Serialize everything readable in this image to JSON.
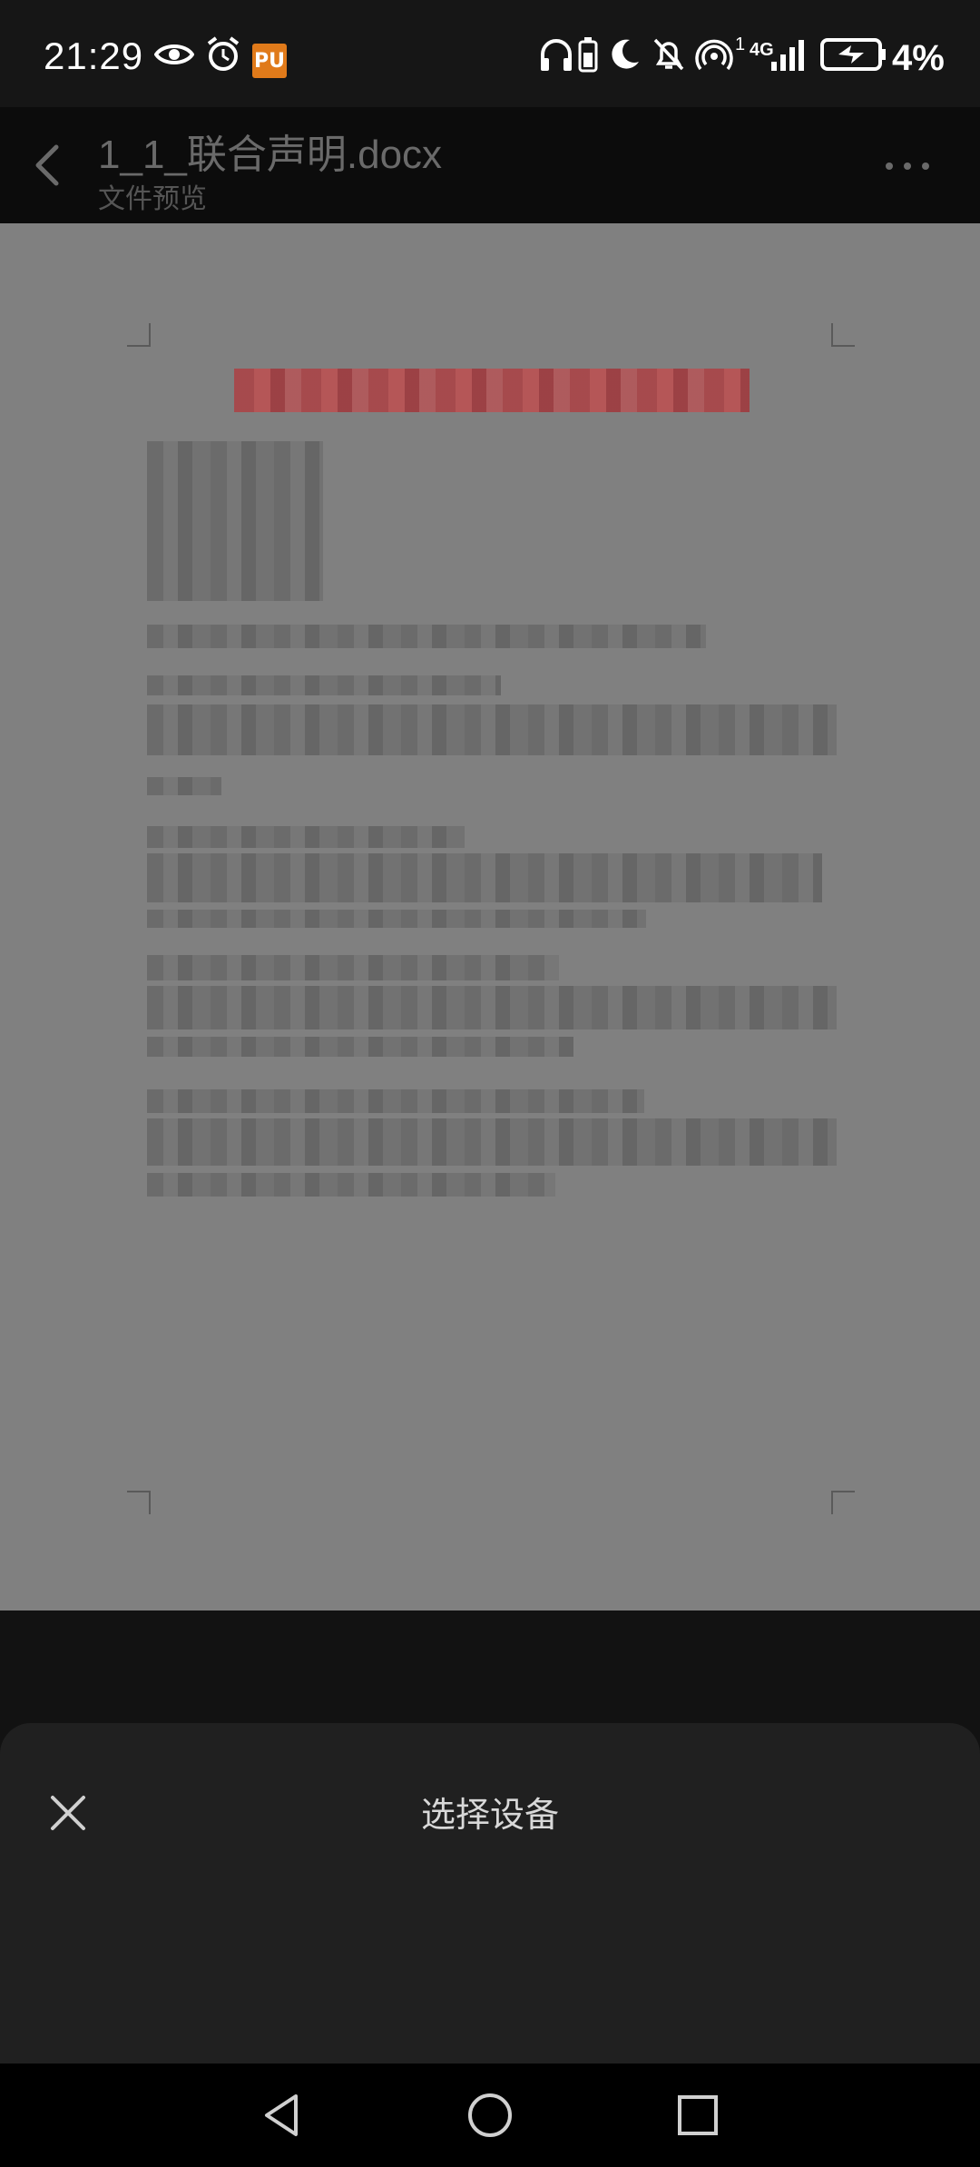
{
  "status_bar": {
    "time": "21:29",
    "battery_percent": "4%",
    "network_label": "4G",
    "sim_slot": "1",
    "app_badge": "PU",
    "icons": [
      "eye-icon",
      "alarm-icon",
      "pu-app-icon",
      "headphones-icon",
      "battery-saver-icon",
      "moon-icon",
      "notifications-off-icon",
      "hotspot-icon",
      "signal-icon",
      "charging-battery-icon"
    ]
  },
  "app_bar": {
    "title": "1_1_联合声明.docx",
    "subtitle": "文件预览",
    "back_icon": "chevron-left-icon",
    "more_icon": "more-horizontal-icon"
  },
  "preview": {
    "document_text_redacted": true,
    "title_color": "#b2474b"
  },
  "bottom_sheet": {
    "title": "选择设备",
    "close_icon": "close-icon"
  },
  "nav_bar": {
    "icons": [
      "back-triangle-icon",
      "home-circle-icon",
      "recents-square-icon"
    ]
  },
  "colors": {
    "status_bar_bg": "#161616",
    "app_bar_bg": "#0c0c0c",
    "preview_bg": "#808080",
    "sheet_bg": "#202020",
    "nav_bg": "#000000"
  }
}
